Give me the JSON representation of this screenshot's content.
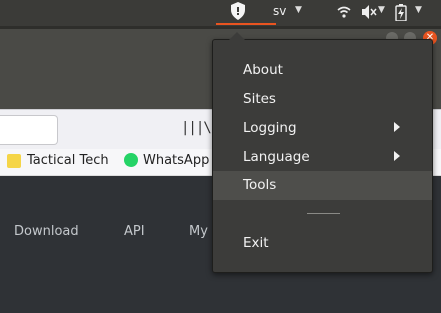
{
  "top_panel": {
    "language": "sv",
    "indicators": [
      "shield-icon",
      "wifi-icon",
      "volume-icon",
      "battery-icon"
    ],
    "accent": "#e95420"
  },
  "browser": {
    "bookmarks": [
      {
        "label": "Tactical Tech",
        "icon": "folder-icon"
      },
      {
        "label": "WhatsApp",
        "icon": "whatsapp-icon"
      }
    ],
    "site_nav": [
      "Download",
      "API",
      "My"
    ]
  },
  "menu": {
    "items": [
      {
        "label": "About"
      },
      {
        "label": "Sites"
      },
      {
        "label": "Logging",
        "submenu": true
      },
      {
        "label": "Language",
        "submenu": true
      },
      {
        "label": "Tools",
        "highlighted": true
      },
      {
        "label": "Exit"
      }
    ]
  }
}
